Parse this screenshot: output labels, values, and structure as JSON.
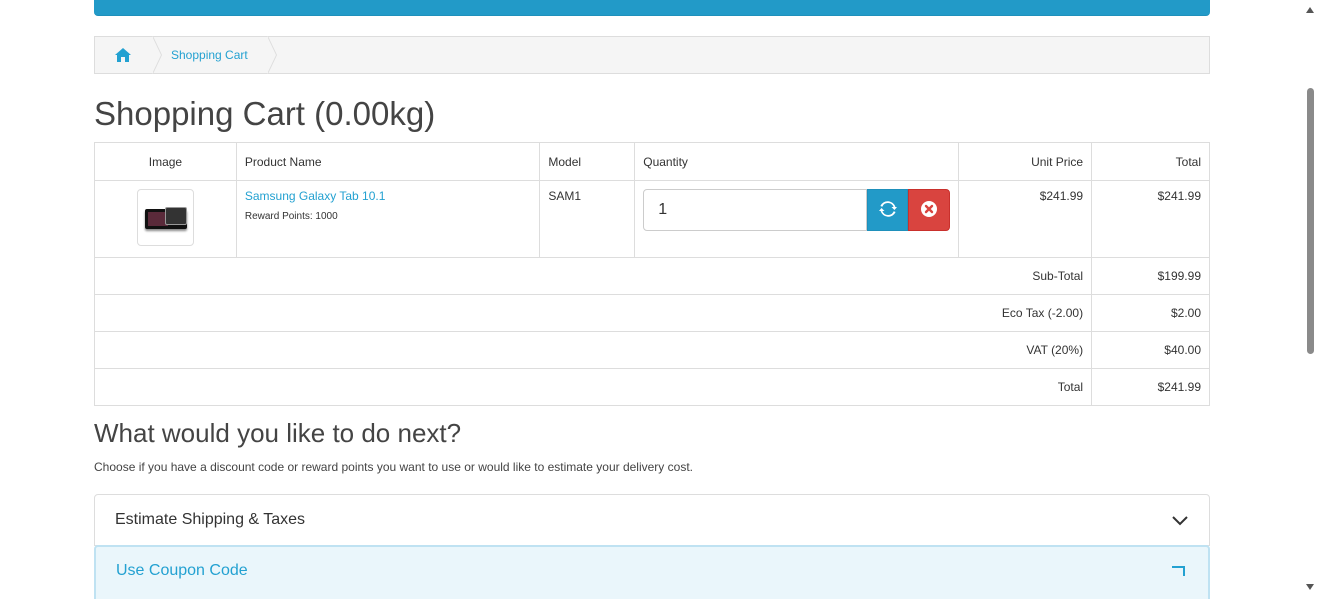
{
  "breadcrumb": {
    "home_icon": "home-icon",
    "items": [
      "Shopping Cart"
    ]
  },
  "page_title": "Shopping Cart (0.00kg)",
  "cart": {
    "headers": {
      "image": "Image",
      "product_name": "Product Name",
      "model": "Model",
      "quantity": "Quantity",
      "unit_price": "Unit Price",
      "total": "Total"
    },
    "items": [
      {
        "name": "Samsung Galaxy Tab 10.1",
        "reward": "Reward Points: 1000",
        "model": "SAM1",
        "quantity": "1",
        "unit_price": "$241.99",
        "total": "$241.99",
        "update_icon": "refresh-icon",
        "remove_icon": "remove-circle-icon"
      }
    ],
    "totals": [
      {
        "label": "Sub-Total",
        "value": "$199.99"
      },
      {
        "label": "Eco Tax (-2.00)",
        "value": "$2.00"
      },
      {
        "label": "VAT (20%)",
        "value": "$40.00"
      },
      {
        "label": "Total",
        "value": "$241.99"
      }
    ]
  },
  "next": {
    "heading": "What would you like to do next?",
    "description": "Choose if you have a discount code or reward points you want to use or would like to estimate your delivery cost."
  },
  "panels": {
    "shipping": "Estimate Shipping & Taxes",
    "coupon": "Use Coupon Code"
  },
  "colors": {
    "primary": "#229ac8",
    "danger": "#d9443f",
    "link": "#23a1d1"
  }
}
